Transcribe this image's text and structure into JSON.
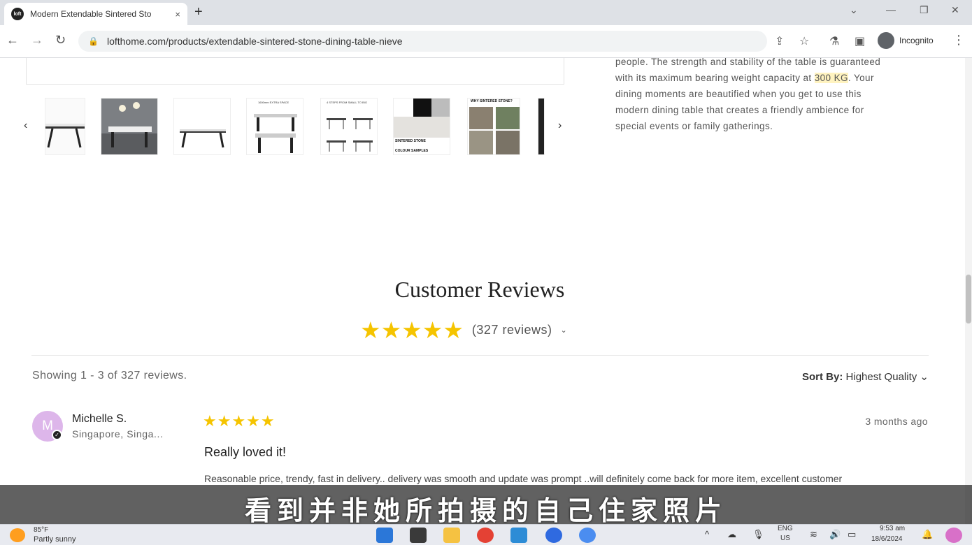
{
  "browser": {
    "tab_title": "Modern Extendable Sintered Sto",
    "tab_close": "×",
    "new_tab": "+",
    "favicon_text": "loft",
    "url": "lofthome.com/products/extendable-sintered-stone-dining-table-nieve",
    "incognito_label": "Incognito"
  },
  "product": {
    "description_lines": [
      "people. The strength and stability of the table is guaranteed",
      "with its maximum bearing weight capacity at 300 KG. Your",
      "dining moments are beautified when you get to use this",
      "modern dining table that creates a friendly ambience for",
      "special events or family gatherings."
    ],
    "thumb_labels": {
      "dim": "1600mm EXTRA SPACE",
      "steps": "4 STEPS FROM SMALL TO BIG",
      "sintered": "SINTERED STONE",
      "colour": "COLOUR SAMPLES",
      "why": "WHY SINTERED STONE?"
    },
    "gallery_prev": "‹",
    "gallery_next": "›"
  },
  "reviews": {
    "title": "Customer Reviews",
    "stars": "★★★★★",
    "count_label": "(327 reviews)",
    "showing": "Showing 1 - 3 of 327 reviews.",
    "sort_label": "Sort By:",
    "sort_value": "Highest Quality",
    "items": [
      {
        "avatar_initial": "M",
        "name": "Michelle S.",
        "location": "Singapore, Singa...",
        "stars": "★★★★★",
        "date": "3 months ago",
        "heading": "Really loved it!",
        "body": "Reasonable price, trendy, fast in delivery.. delivery was smooth and update was prompt ..will definitely come back for more item, excellent customer"
      }
    ]
  },
  "subtitle": "看到并非她所拍摄的自己住家照片",
  "taskbar": {
    "weather_temp": "85°F",
    "weather_desc": "Partly sunny",
    "lang_top": "ENG",
    "lang_bottom": "US",
    "time": "9:53 am",
    "date": "18/6/2024"
  },
  "colors": {
    "star": "#f5c400",
    "avatar": "#ddb6ea"
  }
}
